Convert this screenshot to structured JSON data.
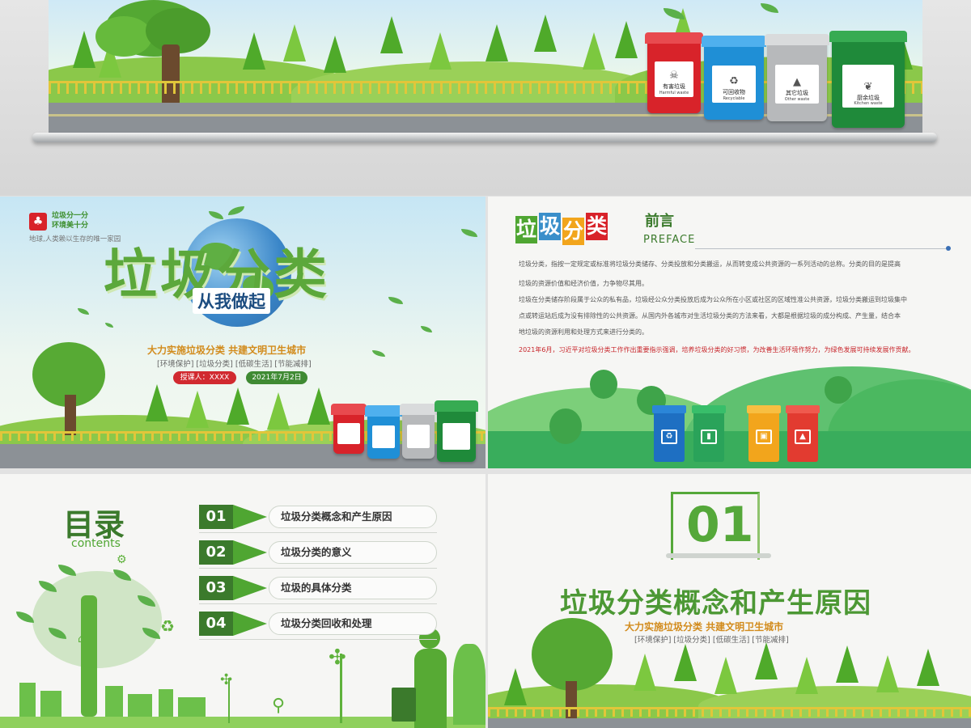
{
  "banner": {
    "bins": [
      {
        "cn": "有害垃圾",
        "en": "Harmful waste",
        "symbol": "☠",
        "color": "#d8232a"
      },
      {
        "cn": "可回收物",
        "en": "Recyclable",
        "symbol": "♻",
        "color": "#1f8fd6"
      },
      {
        "cn": "其它垃圾",
        "en": "Other waste",
        "symbol": "▲",
        "color": "#b7b9bb"
      },
      {
        "cn": "厨余垃圾",
        "en": "Kitchen waste",
        "symbol": "❦",
        "color": "#1f8a3a"
      }
    ]
  },
  "cover": {
    "badge_line1": "垃圾分一分",
    "badge_line2": "环境美十分",
    "motto": "地球,人类赖以生存的唯一家园",
    "big_title": "垃圾分类",
    "subtitle": "从我做起",
    "tagline": "大力实施垃圾分类  共建文明卫生城市",
    "keywords": "[环境保护]  [垃圾分类]  [低碳生活]  [节能减排]",
    "speaker": "授课人：XXXX",
    "date": "2021年7月2日"
  },
  "preface": {
    "title_chars": [
      "垃",
      "圾",
      "分",
      "类"
    ],
    "heading_cn": "前言",
    "heading_en": "PREFACE",
    "lines": [
      "垃圾分类，指按一定规定或标准将垃圾分类储存、分类投放和分类搬运，从而转变成公共资源的一系列活动的总称。分类的目的是提高",
      "垃圾的资源价值和经济价值，力争物尽其用。",
      "垃圾在分类储存阶段属于公众的私有品，垃圾经公众分类投放后成为公众所在小区或社区的区域性准公共资源，垃圾分类搬运到垃圾集中",
      "点或转运站后成为没有排除性的公共资源。从国内外各城市对生活垃圾分类的方法来看，大都是根据垃圾的成分构成、产生量，结合本",
      "地垃圾的资源利用和处理方式来进行分类的。"
    ],
    "highlight": "2021年6月，习近平对垃圾分类工作作出重要指示强调，培养垃圾分类的好习惯，为改善生活环境作努力，为绿色发展可持续发展作贡献。",
    "accent_red": "#c8262b",
    "bin_colors": [
      "#1e6fc2",
      "#2aa35a",
      "#f2a51c",
      "#e23b30"
    ]
  },
  "contents": {
    "title": "目录",
    "subtitle": "contents",
    "items": [
      {
        "num": "01",
        "label": "垃圾分类概念和产生原因"
      },
      {
        "num": "02",
        "label": "垃圾分类的意义"
      },
      {
        "num": "03",
        "label": "垃圾的具体分类"
      },
      {
        "num": "04",
        "label": "垃圾分类回收和处理"
      }
    ]
  },
  "section": {
    "number": "01",
    "title": "垃圾分类概念和产生原因",
    "tagline": "大力实施垃圾分类  共建文明卫生城市",
    "keywords": "[环境保护]  [垃圾分类]  [低碳生活]  [节能减排]"
  },
  "colors": {
    "brand_green": "#4fa632",
    "dark_green": "#3b7a2c",
    "orange": "#d28b1c"
  }
}
